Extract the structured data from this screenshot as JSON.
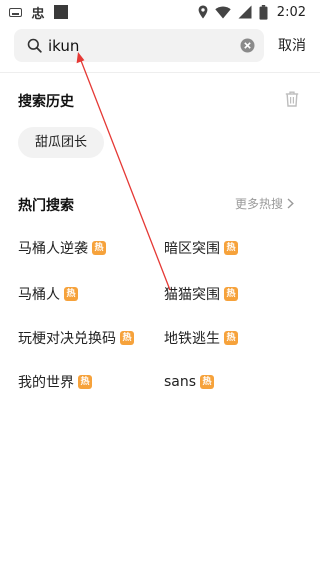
{
  "status_bar": {
    "app_glyph": "忠",
    "time": "2:02"
  },
  "search": {
    "value": "ikun",
    "cancel_label": "取消"
  },
  "history": {
    "title": "搜索历史",
    "items": [
      "甜瓜团长"
    ]
  },
  "hot": {
    "title": "热门搜索",
    "more_label": "更多热搜",
    "badge": "热",
    "badge_color": "#f6a23b",
    "items": [
      "马桶人逆袭",
      "暗区突围",
      "马桶人",
      "猫猫突围",
      "玩梗对决兑换码",
      "地铁逃生",
      "我的世界",
      "sans"
    ]
  },
  "annotation_color": "#e53935"
}
